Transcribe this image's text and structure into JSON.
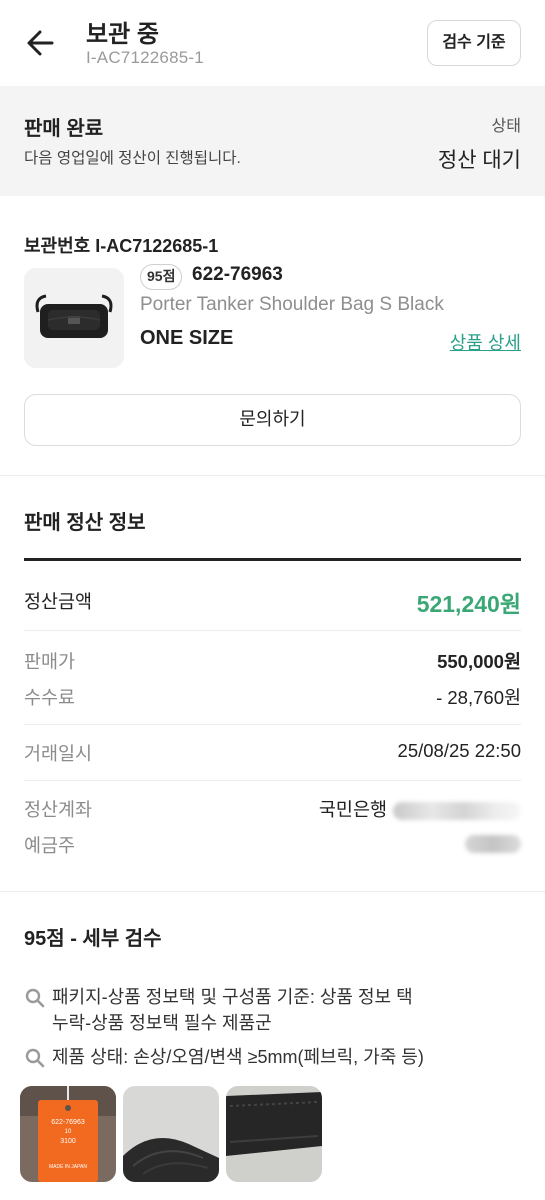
{
  "header": {
    "title": "보관 중",
    "subtitle": "I-AC7122685-1",
    "criteria_button": "검수 기준"
  },
  "status": {
    "title": "판매 완료",
    "description": "다음 영업일에 정산이 진행됩니다.",
    "label": "상태",
    "value": "정산 대기"
  },
  "product": {
    "storage_number": "보관번호 I-AC7122685-1",
    "grade": "95점",
    "model_number": "622-76963",
    "name": "Porter Tanker Shoulder Bag S Black",
    "size": "ONE SIZE",
    "detail_link": "상품 상세",
    "inquiry_button": "문의하기"
  },
  "settlement": {
    "title": "판매 정산 정보",
    "amount_label": "정산금액",
    "amount_value": "521,240원",
    "sale_price_label": "판매가",
    "sale_price_value": "550,000원",
    "fee_label": "수수료",
    "fee_value": "- 28,760원",
    "date_label": "거래일시",
    "date_value": "25/08/25 22:50",
    "account_label": "정산계좌",
    "account_bank": "국민은행",
    "holder_label": "예금주",
    "accent_color": "#3aa775"
  },
  "inspection": {
    "title": "95점 - 세부 검수",
    "items": [
      {
        "line1": "패키지-상품 정보택 및 구성품 기준: 상품 정보 택",
        "line2": "누락-상품 정보택 필수 제품군"
      },
      {
        "line1": "제품 상태: 손상/오염/변색 ≥5mm(페브릭, 가죽 등)"
      }
    ],
    "tag_text": {
      "line1": "622-76963",
      "line2": "10",
      "line3": "3100",
      "line4": "MADE IN JAPAN"
    }
  },
  "icons": {
    "back": "arrow-left-icon",
    "search": "magnifier-icon"
  }
}
